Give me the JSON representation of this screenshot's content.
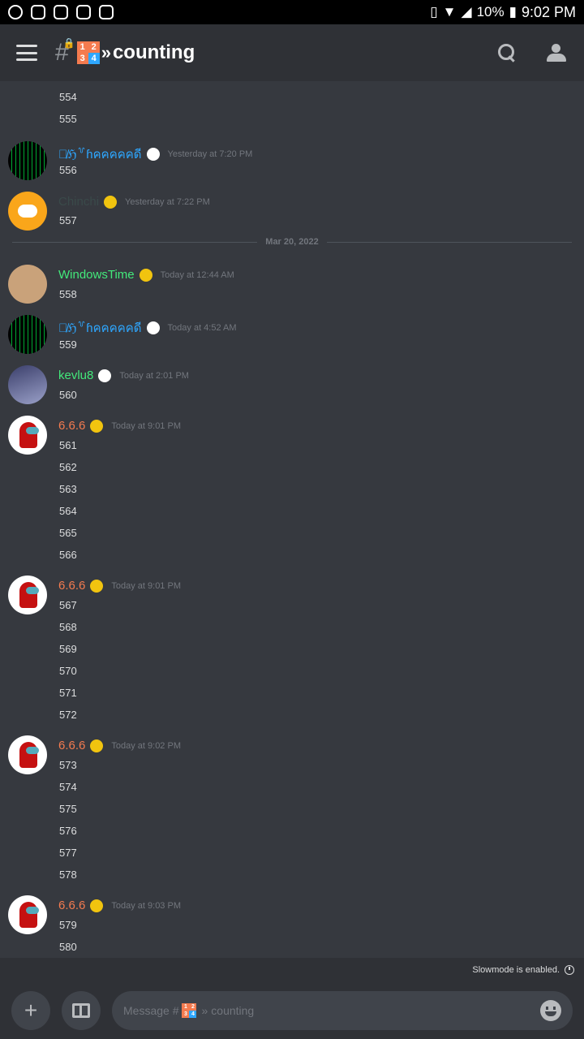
{
  "status": {
    "battery": "10%",
    "time": "9:02 PM"
  },
  "header": {
    "title": "counting",
    "boxes": [
      "1",
      "2",
      "3",
      "4"
    ]
  },
  "colors": {
    "accent_orange": "#f47b4f",
    "accent_green": "#43e97b",
    "accent_blue": "#2ea7ff"
  },
  "messages": {
    "top_lines": [
      "554",
      "555"
    ],
    "m1": {
      "user": "ꨄ̸ℌ꒷ɦคคคคคดี",
      "time": "Yesterday at 7:20 PM",
      "lines": [
        "556"
      ]
    },
    "m2": {
      "user": "Chinchi",
      "time": "Yesterday at 7:22 PM",
      "lines": [
        "557"
      ]
    },
    "divider": "Mar 20, 2022",
    "m3": {
      "user": "WindowsTime",
      "time": "Today at 12:44 AM",
      "lines": [
        "558"
      ]
    },
    "m4": {
      "user": "ꨄ̸ℌ꒷ɦคคคคคดี",
      "time": "Today at 4:52 AM",
      "lines": [
        "559"
      ]
    },
    "m5": {
      "user": "kevlu8",
      "time": "Today at 2:01 PM",
      "lines": [
        "560"
      ]
    },
    "m6": {
      "user": "6.6.6",
      "time": "Today at 9:01 PM",
      "lines": [
        "561",
        "562",
        "563",
        "564",
        "565",
        "566"
      ]
    },
    "m7": {
      "user": "6.6.6",
      "time": "Today at 9:01 PM",
      "lines": [
        "567",
        "568",
        "569",
        "570",
        "571",
        "572"
      ]
    },
    "m8": {
      "user": "6.6.6",
      "time": "Today at 9:02 PM",
      "lines": [
        "573",
        "574",
        "575",
        "576",
        "577",
        "578"
      ]
    },
    "m9": {
      "user": "6.6.6",
      "time": "Today at 9:03 PM",
      "lines": [
        "579",
        "580"
      ]
    }
  },
  "slowmode": "Slowmode is enabled.",
  "composer": {
    "placeholder_prefix": "Message #",
    "placeholder_suffix": "counting"
  }
}
